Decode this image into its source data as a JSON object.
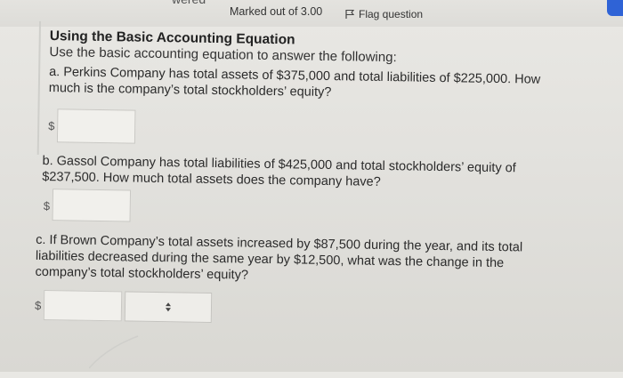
{
  "header": {
    "status_fragment": "wered",
    "marks": "Marked out of 3.00",
    "flag_label": "Flag question"
  },
  "question": {
    "title": "Using the Basic Accounting Equation",
    "instruction": "Use the basic accounting equation to answer the following:",
    "parts": [
      {
        "text": "a. Perkins Company has total assets of $375,000 and total liabilities of $225,000. How much is the company’s total stockholders’ equity?",
        "currency": "$",
        "value": ""
      },
      {
        "text": "b. Gassol Company has total liabilities of $425,000 and total stockholders’ equity of $237,500. How much total assets does the company have?",
        "currency": "$",
        "value": ""
      },
      {
        "text": "c. If Brown Company’s total assets increased by $87,500 during the year, and its total liabilities decreased during the same year by $12,500, what was the change in the company’s total stockholders’ equity?",
        "currency": "$",
        "value": "",
        "select_value": ""
      }
    ]
  },
  "icons": {
    "flag": "flag-icon",
    "select": "up-down-arrows-icon"
  }
}
